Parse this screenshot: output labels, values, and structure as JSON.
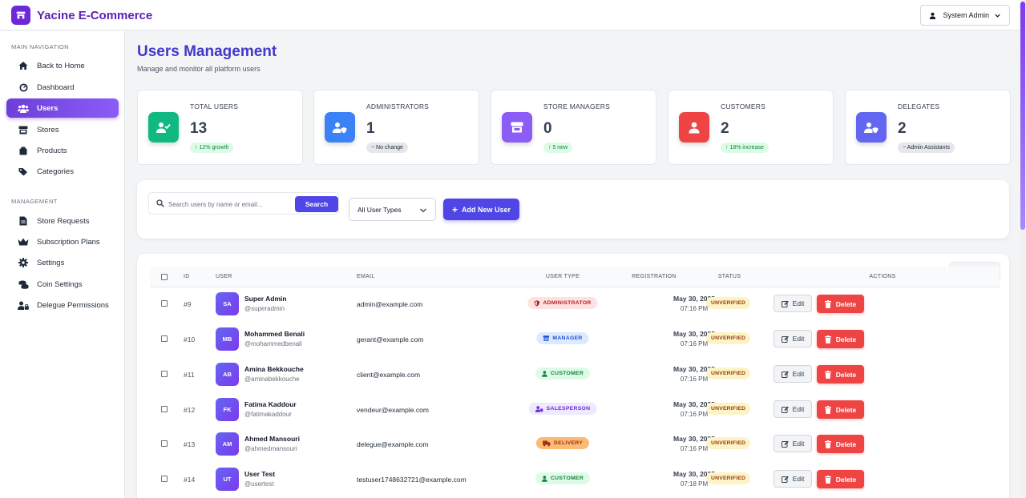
{
  "app": {
    "title": "Yacine E-Commerce"
  },
  "header": {
    "user_label": "System Admin"
  },
  "sidebar": {
    "main_label": "MAIN NAVIGATION",
    "management_label": "MANAGEMENT",
    "items": [
      {
        "label": "Back to Home",
        "icon": "home-icon"
      },
      {
        "label": "Dashboard",
        "icon": "gauge-icon"
      },
      {
        "label": "Users",
        "icon": "users-icon",
        "active": true
      },
      {
        "label": "Stores",
        "icon": "store-icon"
      },
      {
        "label": "Products",
        "icon": "box-icon"
      },
      {
        "label": "Categories",
        "icon": "tags-icon"
      }
    ],
    "management_items": [
      {
        "label": "Store Requests",
        "icon": "document-icon"
      },
      {
        "label": "Subscription Plans",
        "icon": "crown-icon"
      },
      {
        "label": "Settings",
        "icon": "gear-icon"
      },
      {
        "label": "Coin Settings",
        "icon": "coins-icon"
      },
      {
        "label": "Delegue Permissions",
        "icon": "user-lock-icon"
      }
    ]
  },
  "page": {
    "title": "Users Management",
    "subtitle": "Manage and monitor all platform users"
  },
  "stats": [
    {
      "label": "TOTAL USERS",
      "value": "13",
      "badge": "↑ 12% growth",
      "color": "#10b981"
    },
    {
      "label": "ADMINISTRATORS",
      "value": "1",
      "badge": "− No change",
      "color": "#3b82f6"
    },
    {
      "label": "STORE MANAGERS",
      "value": "0",
      "badge": "↑ 5 new",
      "color": "#8b5cf6"
    },
    {
      "label": "CUSTOMERS",
      "value": "2",
      "badge": "↑ 18% increase",
      "color": "#ef4444"
    },
    {
      "label": "DELEGATES",
      "value": "2",
      "badge": "− Admin Assistants",
      "color": "#6366f1"
    }
  ],
  "filters": {
    "search_placeholder": "Search users by name or email...",
    "search_button": "Search",
    "type_select": "All User Types",
    "add_button": "Add New User"
  },
  "table": {
    "headers": [
      "ID",
      "USER",
      "EMAIL",
      "USER TYPE",
      "REGISTRATION",
      "STATUS",
      "ACTIONS"
    ],
    "edit_label": "Edit",
    "delete_label": "Delete",
    "rows": [
      {
        "id": "#9",
        "initials": "SA",
        "name": "Super Admin",
        "handle": "@superadmin",
        "email": "admin@example.com",
        "type": "ADMINISTRATOR",
        "date": "May 30, 2025",
        "time": "07:16 PM",
        "status": "UNVERIFIED"
      },
      {
        "id": "#10",
        "initials": "MB",
        "name": "Mohammed Benali",
        "handle": "@mohammedbenali",
        "email": "gerant@example.com",
        "type": "MANAGER",
        "date": "May 30, 2025",
        "time": "07:16 PM",
        "status": "UNVERIFIED"
      },
      {
        "id": "#11",
        "initials": "AB",
        "name": "Amina Bekkouche",
        "handle": "@aminabekkouche",
        "email": "client@example.com",
        "type": "CUSTOMER",
        "date": "May 30, 2025",
        "time": "07:16 PM",
        "status": "UNVERIFIED"
      },
      {
        "id": "#12",
        "initials": "FK",
        "name": "Fatima Kaddour",
        "handle": "@fatimakaddour",
        "email": "vendeur@example.com",
        "type": "SALESPERSON",
        "date": "May 30, 2025",
        "time": "07:16 PM",
        "status": "UNVERIFIED"
      },
      {
        "id": "#13",
        "initials": "AM",
        "name": "Ahmed Mansouri",
        "handle": "@ahmedmansouri",
        "email": "delegue@example.com",
        "type": "DELIVERY",
        "date": "May 30, 2025",
        "time": "07:16 PM",
        "status": "UNVERIFIED"
      },
      {
        "id": "#14",
        "initials": "UT",
        "name": "User Test",
        "handle": "@usertest",
        "email": "testuser1748632721@example.com",
        "type": "CUSTOMER",
        "date": "May 30, 2025",
        "time": "07:18 PM",
        "status": "UNVERIFIED"
      }
    ]
  },
  "type_colors": {
    "ADMINISTRATOR": {
      "bg": "#fee2e2",
      "fg": "#b91c1c",
      "icon": "shield-icon"
    },
    "MANAGER": {
      "bg": "#dbeafe",
      "fg": "#1d4ed8",
      "icon": "store-icon"
    },
    "CUSTOMER": {
      "bg": "#dcfce7",
      "fg": "#15803d",
      "icon": "user-icon"
    },
    "SALESPERSON": {
      "bg": "#ede9fe",
      "fg": "#6d28d9",
      "icon": "user-tag-icon"
    },
    "DELIVERY": {
      "bg": "#fdba74",
      "fg": "#9a3412",
      "icon": "truck-icon"
    }
  }
}
